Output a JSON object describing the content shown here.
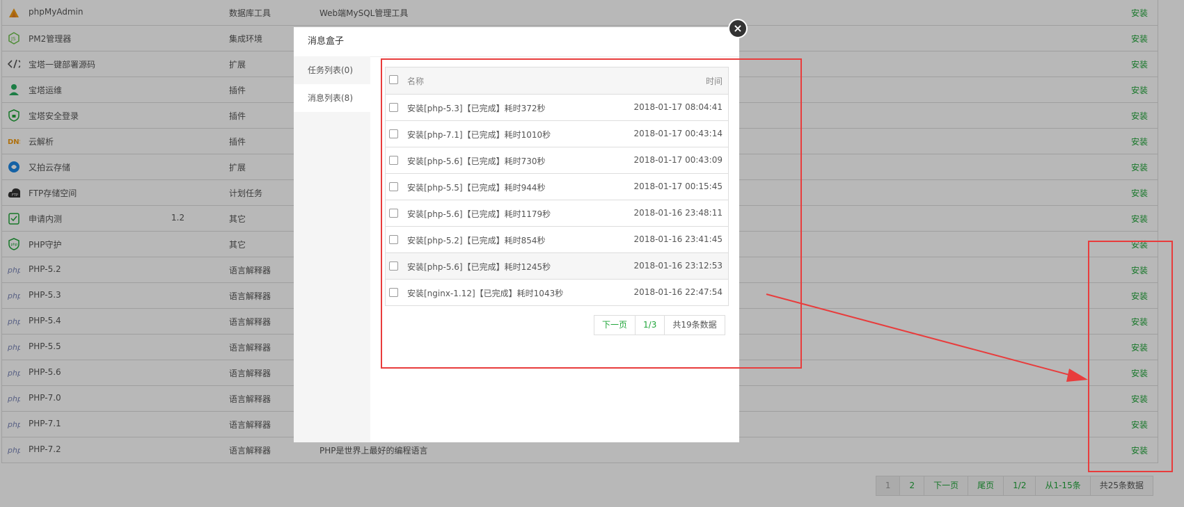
{
  "plugins": [
    {
      "name": "phpMyAdmin",
      "version": "",
      "type": "数据库工具",
      "desc": "Web端MySQL管理工具",
      "action": "安装",
      "icon": "phpmyadmin-icon"
    },
    {
      "name": "PM2管理器",
      "version": "",
      "type": "集成环境",
      "desc": "",
      "action": "安装",
      "icon": "nodejs-icon"
    },
    {
      "name": "宝塔一键部署源码",
      "version": "",
      "type": "扩展",
      "desc": "",
      "action": "安装",
      "icon": "code-icon"
    },
    {
      "name": "宝塔运维",
      "version": "",
      "type": "插件",
      "desc": "",
      "action": "安装",
      "icon": "operator-icon"
    },
    {
      "name": "宝塔安全登录",
      "version": "",
      "type": "插件",
      "desc": "",
      "action": "安装",
      "icon": "shield-icon"
    },
    {
      "name": "云解析",
      "version": "",
      "type": "插件",
      "desc": "",
      "action": "安装",
      "icon": "dns-icon"
    },
    {
      "name": "又拍云存储",
      "version": "",
      "type": "扩展",
      "desc": "",
      "action": "安装",
      "icon": "upyun-icon"
    },
    {
      "name": "FTP存储空间",
      "version": "",
      "type": "计划任务",
      "desc": "",
      "action": "安装",
      "icon": "ftp-cloud-icon"
    },
    {
      "name": "申请内测",
      "version": "1.2",
      "type": "其它",
      "desc": "",
      "action": "安装",
      "icon": "clipboard-icon"
    },
    {
      "name": "PHP守护",
      "version": "",
      "type": "其它",
      "desc": "",
      "action": "安装",
      "icon": "php-shield-icon"
    },
    {
      "name": "PHP-5.2",
      "version": "",
      "type": "语言解释器",
      "desc": "",
      "action": "安装",
      "icon": "php-icon"
    },
    {
      "name": "PHP-5.3",
      "version": "",
      "type": "语言解释器",
      "desc": "",
      "action": "安装",
      "icon": "php-icon"
    },
    {
      "name": "PHP-5.4",
      "version": "",
      "type": "语言解释器",
      "desc": "",
      "action": "安装",
      "icon": "php-icon"
    },
    {
      "name": "PHP-5.5",
      "version": "",
      "type": "语言解释器",
      "desc": "",
      "action": "安装",
      "icon": "php-icon"
    },
    {
      "name": "PHP-5.6",
      "version": "",
      "type": "语言解释器",
      "desc": "",
      "action": "安装",
      "icon": "php-icon"
    },
    {
      "name": "PHP-7.0",
      "version": "",
      "type": "语言解释器",
      "desc": "",
      "action": "安装",
      "icon": "php-icon"
    },
    {
      "name": "PHP-7.1",
      "version": "",
      "type": "语言解释器",
      "desc": "",
      "action": "安装",
      "icon": "php-icon"
    },
    {
      "name": "PHP-7.2",
      "version": "",
      "type": "语言解释器",
      "desc": "PHP是世界上最好的编程语言",
      "action": "安装",
      "icon": "php-icon"
    }
  ],
  "pager": {
    "p1": "1",
    "p2": "2",
    "next": "下一页",
    "last": "尾页",
    "page": "1/2",
    "range": "从1-15条",
    "total": "共25条数据"
  },
  "dialog": {
    "title": "消息盒子",
    "tab_tasks": "任务列表(0)",
    "tab_messages": "消息列表(8)",
    "col_name": "名称",
    "col_time": "时间",
    "messages": [
      {
        "name": "安装[php-5.3]【已完成】耗时372秒",
        "time": "2018-01-17 08:04:41"
      },
      {
        "name": "安装[php-7.1]【已完成】耗时1010秒",
        "time": "2018-01-17 00:43:14"
      },
      {
        "name": "安装[php-5.6]【已完成】耗时730秒",
        "time": "2018-01-17 00:43:09"
      },
      {
        "name": "安装[php-5.5]【已完成】耗时944秒",
        "time": "2018-01-17 00:15:45"
      },
      {
        "name": "安装[php-5.6]【已完成】耗时1179秒",
        "time": "2018-01-16 23:48:11"
      },
      {
        "name": "安装[php-5.2]【已完成】耗时854秒",
        "time": "2018-01-16 23:41:45"
      },
      {
        "name": "安装[php-5.6]【已完成】耗时1245秒",
        "time": "2018-01-16 23:12:53"
      },
      {
        "name": "安装[nginx-1.12]【已完成】耗时1043秒",
        "time": "2018-01-16 22:47:54"
      }
    ],
    "pager": {
      "next": "下一页",
      "page": "1/3",
      "total": "共19条数据"
    }
  },
  "colors": {
    "accent": "#20a53a",
    "annotation": "#e83c3c"
  }
}
